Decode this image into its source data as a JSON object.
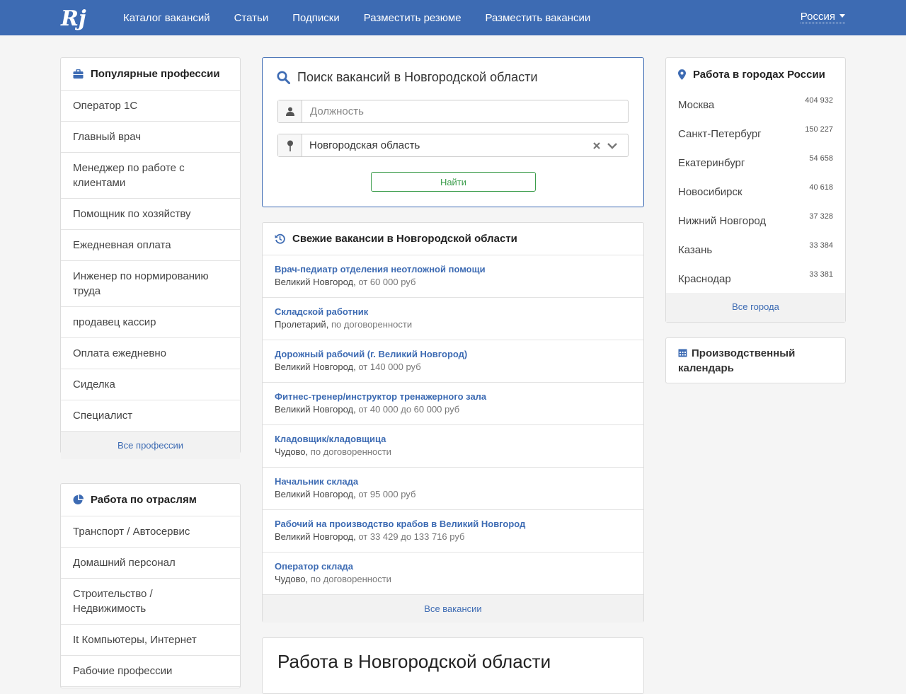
{
  "header": {
    "logo_text": "Rj",
    "nav": [
      "Каталог вакансий",
      "Статьи",
      "Подписки",
      "Разместить резюме",
      "Разместить вакансии"
    ],
    "region": "Россия"
  },
  "professions": {
    "title": "Популярные профессии",
    "items": [
      "Оператор 1С",
      "Главный врач",
      "Менеджер по работе с клиентами",
      "Помощник по хозяйству",
      "Ежедневная оплата",
      "Инженер по нормированию труда",
      "продавец кассир",
      "Оплата ежедневно",
      "Сиделка",
      "Специалист"
    ],
    "all_link": "Все профессии"
  },
  "industries": {
    "title": "Работа по отраслям",
    "items": [
      "Транспорт / Автосервис",
      "Домашний персонал",
      "Строительство / Недвижимость",
      "It Компьютеры, Интернет",
      "Рабочие профессии"
    ]
  },
  "search": {
    "title": "Поиск вакансий в Новгородской области",
    "position_placeholder": "Должность",
    "region_value": "Новгородская область",
    "button": "Найти"
  },
  "fresh": {
    "title": "Свежие вакансии в Новгородской области",
    "items": [
      {
        "title": "Врач-педиатр отделения неотложной помощи",
        "city": "Великий Новгород",
        "salary": "от 60 000 руб"
      },
      {
        "title": "Складской работник",
        "city": "Пролетарий",
        "salary": "по договоренности"
      },
      {
        "title": "Дорожный рабочий (г. Великий Новгород)",
        "city": "Великий Новгород",
        "salary": "от 140 000 руб"
      },
      {
        "title": "Фитнес-тренер/инструктор тренажерного зала",
        "city": "Великий Новгород",
        "salary": "от 40 000 до 60 000 руб"
      },
      {
        "title": "Кладовщик/кладовщица",
        "city": "Чудово",
        "salary": "по договоренности"
      },
      {
        "title": "Начальник склада",
        "city": "Великий Новгород",
        "salary": "от 95 000 руб"
      },
      {
        "title": "Рабочий на производство крабов в Великий Новгород",
        "city": "Великий Новгород",
        "salary": "от 33 429 до 133 716 руб"
      },
      {
        "title": "Оператор склада",
        "city": "Чудово",
        "salary": "по договоренности"
      }
    ],
    "all_link": "Все вакансии"
  },
  "region_heading": "Работа в Новгородской области",
  "cities": {
    "title": "Работа в городах России",
    "items": [
      {
        "name": "Москва",
        "count": "404 932"
      },
      {
        "name": "Санкт-Петербург",
        "count": "150 227"
      },
      {
        "name": "Екатеринбург",
        "count": "54 658"
      },
      {
        "name": "Новосибирск",
        "count": "40 618"
      },
      {
        "name": "Нижний Новгород",
        "count": "37 328"
      },
      {
        "name": "Казань",
        "count": "33 384"
      },
      {
        "name": "Краснодар",
        "count": "33 381"
      }
    ],
    "all_link": "Все города"
  },
  "calendar": {
    "title": "Производственный календарь"
  },
  "colors": {
    "brand": "#3d6bb3",
    "success": "#3a9c4a"
  }
}
